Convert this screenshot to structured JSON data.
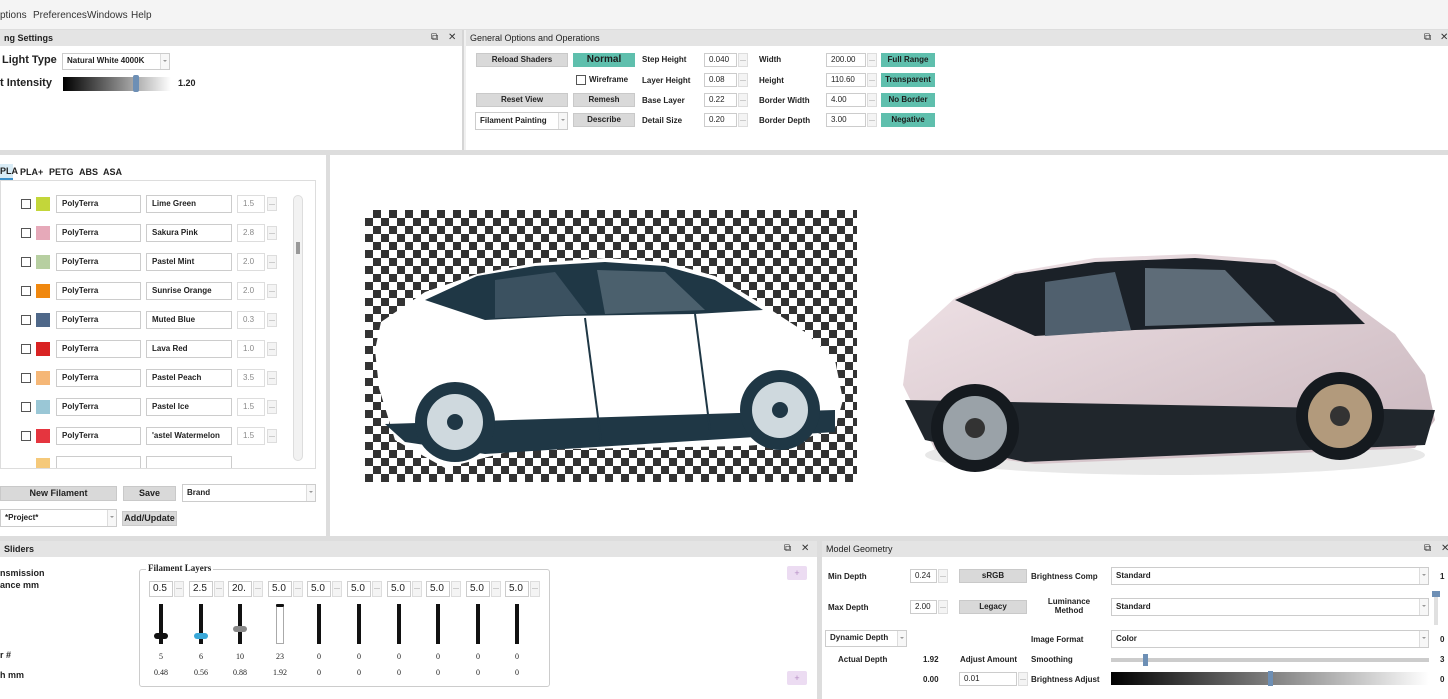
{
  "menu": {
    "items": [
      "ptions",
      "Preferences",
      "Windows",
      "Help"
    ]
  },
  "lighting": {
    "title": "ng Settings",
    "light_type_label": "Light Type",
    "light_type_value": "Natural White 4000K",
    "intensity_label": "t Intensity",
    "intensity_value": "1.20",
    "intensity_level": 0.6
  },
  "general": {
    "title": "General Options and Operations",
    "reload": "Reload Shaders",
    "normal": "Normal",
    "wireframe": "Wireframe",
    "reset": "Reset View",
    "remesh": "Remesh",
    "mode": "Filament Painting",
    "describe": "Describe",
    "step_height_label": "Step Height",
    "step_height": "0.040",
    "layer_height_label": "Layer Height",
    "layer_height": "0.08",
    "base_layer_label": "Base Layer",
    "base_layer": "0.22",
    "detail_size_label": "Detail Size",
    "detail_size": "0.20",
    "width_label": "Width",
    "width": "200.00",
    "height_label": "Height",
    "height": "110.60",
    "border_width_label": "Border Width",
    "border_width": "4.00",
    "border_depth_label": "Border Depth",
    "border_depth": "3.00",
    "full_range": "Full Range",
    "transparent": "Transparent",
    "no_border": "No Border",
    "negative": "Negative"
  },
  "filaments": {
    "tabs": [
      "PLA",
      "PLA+",
      "PETG",
      "ABS",
      "ASA"
    ],
    "items": [
      {
        "brand": "PolyTerra",
        "name": "Lime Green",
        "value": "1.5",
        "color": "#c3d63a"
      },
      {
        "brand": "PolyTerra",
        "name": "Sakura Pink",
        "value": "2.8",
        "color": "#e6a9b9"
      },
      {
        "brand": "PolyTerra",
        "name": "Pastel Mint",
        "value": "2.0",
        "color": "#b7cfa1"
      },
      {
        "brand": "PolyTerra",
        "name": "Sunrise Orange",
        "value": "2.0",
        "color": "#f0880f"
      },
      {
        "brand": "PolyTerra",
        "name": "Muted Blue",
        "value": "0.3",
        "color": "#4f6889"
      },
      {
        "brand": "PolyTerra",
        "name": "Lava Red",
        "value": "1.0",
        "color": "#d92323"
      },
      {
        "brand": "PolyTerra",
        "name": "Pastel Peach",
        "value": "3.5",
        "color": "#f5b777"
      },
      {
        "brand": "PolyTerra",
        "name": "Pastel Ice",
        "value": "1.5",
        "color": "#9ac7d6"
      },
      {
        "brand": "PolyTerra",
        "name": "'astel Watermelon",
        "value": "1.5",
        "color": "#e5353f"
      }
    ],
    "new_filament": "New Filament",
    "save": "Save",
    "brand_select": "Brand",
    "project": "*Project*",
    "add_update": "Add/Update"
  },
  "sliders": {
    "title": "Sliders",
    "transmission": "nsmission",
    "distance": "ance mm",
    "num_label": "r #",
    "depth_label": "h mm",
    "group": "Filament Layers",
    "values": [
      "0.5",
      "2.5",
      "20.",
      "5.0",
      "5.0",
      "5.0",
      "5.0",
      "5.0",
      "5.0",
      "5.0"
    ],
    "counts": [
      "5",
      "6",
      "10",
      "23",
      "0",
      "0",
      "0",
      "0",
      "0",
      "0"
    ],
    "depths": [
      "0.48",
      "0.56",
      "0.88",
      "1.92",
      "0",
      "0",
      "0",
      "0",
      "0",
      "0"
    ],
    "thumb_colors": [
      "#111111",
      "#3aa8d8",
      "#888888",
      "#111111",
      "#111111",
      "#111111",
      "#111111",
      "#111111",
      "#111111",
      "#111111"
    ],
    "levels": [
      0.15,
      0.15,
      0.35,
      1.0,
      0,
      0,
      0,
      0,
      0,
      0
    ],
    "plus": "+"
  },
  "geometry": {
    "title": "Model Geometry",
    "min_depth_label": "Min Depth",
    "min_depth": "0.24",
    "srgb": "sRGB",
    "max_depth_label": "Max Depth",
    "max_depth": "2.00",
    "legacy": "Legacy",
    "dynamic_depth": "Dynamic Depth",
    "actual_depth_label": "Actual Depth",
    "actual_depth": "1.92",
    "adjust_amount_label": "Adjust Amount",
    "adjust_amount": "0.01",
    "extra_value": "0.00",
    "brightness_comp_label": "Brightness Comp",
    "brightness_comp": "Standard",
    "luminance_label": "Luminance Method",
    "luminance": "Standard",
    "image_format_label": "Image Format",
    "image_format": "Color",
    "smoothing_label": "Smoothing",
    "brightness_adjust_label": "Brightness Adjust",
    "right_edge": [
      "1",
      "",
      "0",
      "3",
      "0"
    ]
  }
}
